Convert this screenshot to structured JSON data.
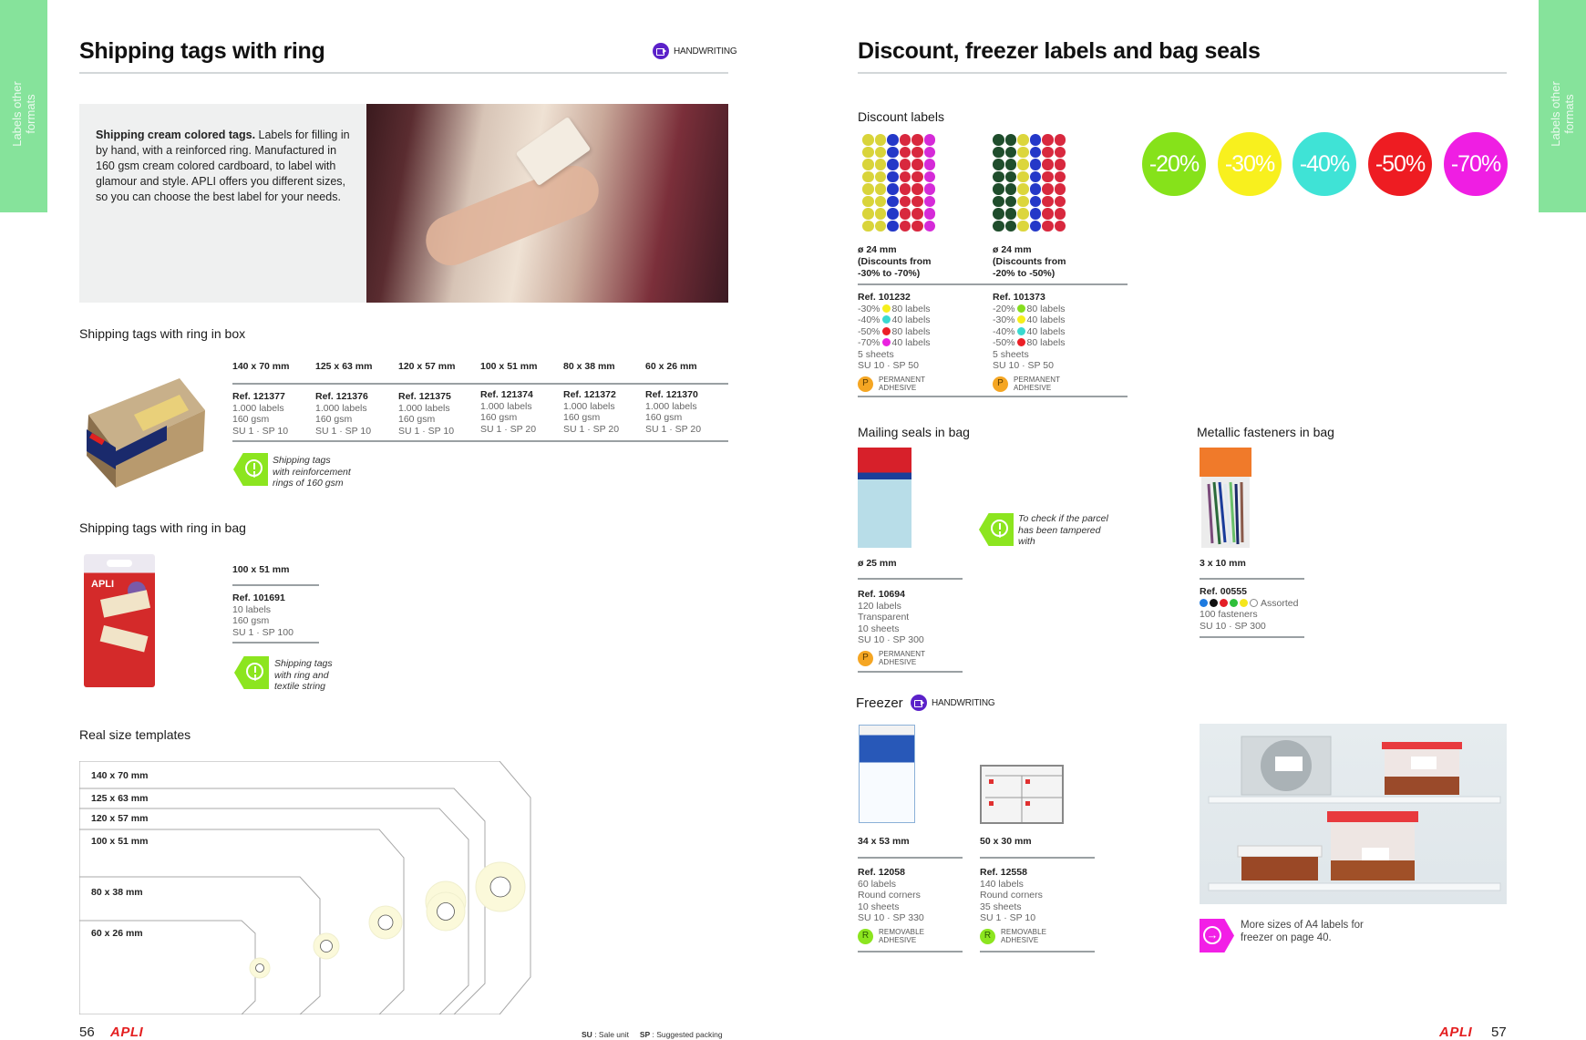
{
  "side_tabs": {
    "left": {
      "line1": "Labels other",
      "line2": "formats"
    },
    "right": {
      "line1": "Labels other",
      "line2": "formats"
    }
  },
  "colors": {
    "side_tab": "#86e39b",
    "info_green": "#8ce51f",
    "handwriting_purple": "#5b21c9",
    "apli_red": "#e41f20",
    "arrow_magenta": "#f21fe6"
  },
  "left_page": {
    "title": "Shipping tags with ring",
    "handwriting_badge": "HANDWRITING",
    "intro": {
      "bold": "Shipping cream colored tags.",
      "text": " Labels for filling in by hand, with a reinforced ring. Manufactured in 160 gsm cream colored cardboard, to label with glamour and style. APLI offers you different sizes, so you can choose the best label for your needs."
    },
    "box_section": {
      "title": "Shipping tags with ring in box",
      "columns": [
        {
          "size": "140 x 70 mm",
          "ref": "Ref. 121377",
          "qty": "1.000 labels",
          "weight": "160 gsm",
          "pack": "SU 1 · SP 10"
        },
        {
          "size": "125 x 63 mm",
          "ref": "Ref. 121376",
          "qty": "1.000 labels",
          "weight": "160 gsm",
          "pack": "SU 1 · SP 10"
        },
        {
          "size": "120 x 57 mm",
          "ref": "Ref. 121375",
          "qty": "1.000 labels",
          "weight": "160 gsm",
          "pack": "SU 1 · SP 10"
        },
        {
          "size": "100 x 51 mm",
          "ref": "Ref. 121374",
          "qty": "1.000 labels",
          "weight": "160 gsm",
          "pack": "SU 1 · SP 20"
        },
        {
          "size": "80 x 38 mm",
          "ref": "Ref. 121372",
          "qty": "1.000 labels",
          "weight": "160 gsm",
          "pack": "SU 1 · SP 20"
        },
        {
          "size": "60 x 26 mm",
          "ref": "Ref. 121370",
          "qty": "1.000 labels",
          "weight": "160 gsm",
          "pack": "SU 1 · SP 20"
        }
      ],
      "note": [
        "Shipping tags",
        "with reinforcement",
        "rings of 160 gsm"
      ]
    },
    "bag_section": {
      "title": "Shipping tags with ring in bag",
      "size": "100 x 51 mm",
      "ref": "Ref. 101691",
      "qty": "10 labels",
      "weight": "160 gsm",
      "pack": "SU 1 · SP 100",
      "note": [
        "Shipping tags",
        "with ring and",
        "textile string"
      ]
    },
    "templates": {
      "title": "Real size templates",
      "sizes": [
        "140 x 70 mm",
        "125 x 63 mm",
        "120 x 57 mm",
        "100 x 51 mm",
        "80 x 38 mm",
        "60 x 26 mm"
      ]
    },
    "footer": {
      "page_number": "56",
      "logo": "APLI",
      "su_key": "SU",
      "su_value": ": Sale unit",
      "sp_key": "SP",
      "sp_value": ": Suggested packing"
    }
  },
  "right_page": {
    "title": "Discount, freezer labels and bag seals",
    "discount": {
      "title": "Discount labels",
      "products": [
        {
          "size": "ø 24 mm",
          "desc1": "(Discounts from",
          "desc2": "-30% to -70%)",
          "ref": "Ref. 101232",
          "lines": [
            {
              "pct": "-30%",
              "color": "#f5ef1c",
              "qty": "80 labels"
            },
            {
              "pct": "-40%",
              "color": "#3ad9d0",
              "qty": "40 labels"
            },
            {
              "pct": "-50%",
              "color": "#ec1f26",
              "qty": "80 labels"
            },
            {
              "pct": "-70%",
              "color": "#ea22e0",
              "qty": "40 labels"
            }
          ],
          "sheets": "5 sheets",
          "pack": "SU 10 · SP 50",
          "adhesive_letter": "P",
          "adhesive1": "PERMANENT",
          "adhesive2": "ADHESIVE"
        },
        {
          "size": "ø 24 mm",
          "desc1": "(Discounts from",
          "desc2": "-20% to -50%)",
          "ref": "Ref. 101373",
          "lines": [
            {
              "pct": "-20%",
              "color": "#86de1f",
              "qty": "80 labels"
            },
            {
              "pct": "-30%",
              "color": "#f5ef1c",
              "qty": "40 labels"
            },
            {
              "pct": "-40%",
              "color": "#3ad9d0",
              "qty": "40 labels"
            },
            {
              "pct": "-50%",
              "color": "#ec1f26",
              "qty": "80 labels"
            }
          ],
          "sheets": "5 sheets",
          "pack": "SU 10 · SP 50",
          "adhesive_letter": "P",
          "adhesive1": "PERMANENT",
          "adhesive2": "ADHESIVE"
        }
      ],
      "swatches": [
        {
          "label": "-20%",
          "color": "#86e21a"
        },
        {
          "label": "-30%",
          "color": "#f8f01e"
        },
        {
          "label": "-40%",
          "color": "#3fe3d6"
        },
        {
          "label": "-50%",
          "color": "#ee1c22"
        },
        {
          "label": "-70%",
          "color": "#ef1ee3"
        }
      ]
    },
    "mailing": {
      "title": "Mailing seals in bag",
      "size": "ø 25 mm",
      "ref": "Ref. 10694",
      "qty": "120 labels",
      "color": "Transparent",
      "sheets": "10 sheets",
      "pack": "SU 10 · SP 300",
      "adhesive_letter": "P",
      "adhesive1": "PERMANENT",
      "adhesive2": "ADHESIVE",
      "note": [
        "To check if the parcel",
        "has been tampered",
        "with"
      ]
    },
    "fasteners": {
      "title": "Metallic fasteners in bag",
      "size": "3 x 10 mm",
      "ref": "Ref. 00555",
      "dots": [
        "#1e7be0",
        "#111111",
        "#e41f26",
        "#2fbf3a",
        "#f5e61c",
        "#ffffff"
      ],
      "assorted": "Assorted",
      "qty": "100 fasteners",
      "pack": "SU 10 · SP 300"
    },
    "freezer": {
      "title": "Freezer",
      "handwriting_badge": "HANDWRITING",
      "products": [
        {
          "size": "34 x 53 mm",
          "ref": "Ref. 12058",
          "qty": "60 labels",
          "shape": "Round corners",
          "sheets": "10 sheets",
          "pack": "SU 10 · SP 330",
          "adhesive_letter": "R",
          "adhesive1": "REMOVABLE",
          "adhesive2": "ADHESIVE"
        },
        {
          "size": "50 x 30 mm",
          "ref": "Ref. 12558",
          "qty": "140 labels",
          "shape": "Round corners",
          "sheets": "35 sheets",
          "pack": "SU 1 · SP 10",
          "adhesive_letter": "R",
          "adhesive1": "REMOVABLE",
          "adhesive2": "ADHESIVE"
        }
      ],
      "more_note": [
        "More sizes of A4 labels for",
        "freezer on page 40."
      ]
    },
    "footer": {
      "logo": "APLI",
      "page_number": "57"
    }
  }
}
